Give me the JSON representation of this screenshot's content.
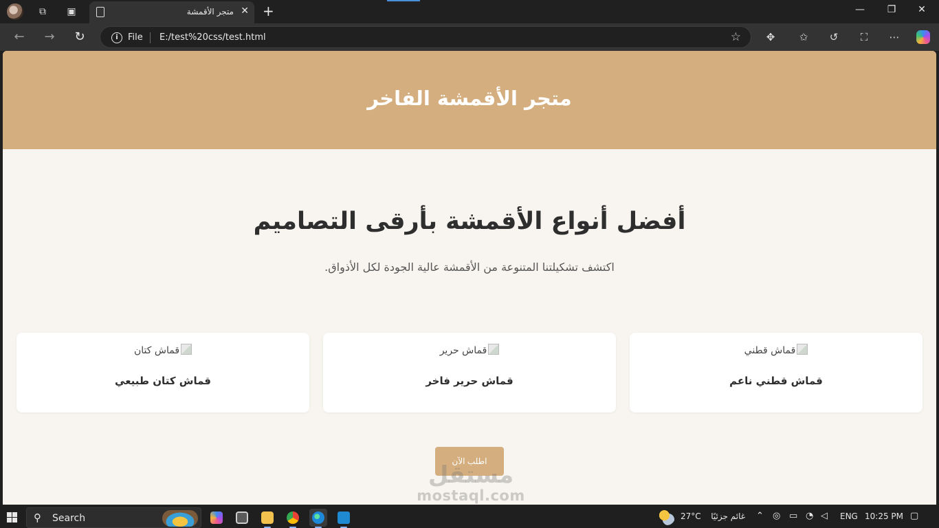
{
  "browser": {
    "tab_title": "متجر الأقمشة",
    "url_scheme": "File",
    "url": "E:/test%20css/test.html"
  },
  "page": {
    "header_title": "متجر الأقمشة الفاخر",
    "hero_title": "أفضل أنواع الأقمشة بأرقى التصاميم",
    "hero_subtitle": "اكتشف تشكيلتنا المتنوعة من الأقمشة عالية الجودة لكل الأذواق.",
    "cards": [
      {
        "img_alt": "قماش قطني",
        "title": "قماش قطني ناعم"
      },
      {
        "img_alt": "قماش حرير",
        "title": "قماش حرير فاخر"
      },
      {
        "img_alt": "قماش كتان",
        "title": "قماش كتان طبيعي"
      }
    ],
    "order_button": "اطلب الآن",
    "colors": {
      "accent": "#d4ae7f",
      "background": "#f8f5f0",
      "card": "#ffffff"
    }
  },
  "watermark": {
    "arabic": "مستقل",
    "latin": "mostaql.com"
  },
  "taskbar": {
    "search_label": "Search",
    "temperature": "27°C",
    "weather": "غائم جزئيًا",
    "language": "ENG",
    "time": "10:25 PM"
  }
}
